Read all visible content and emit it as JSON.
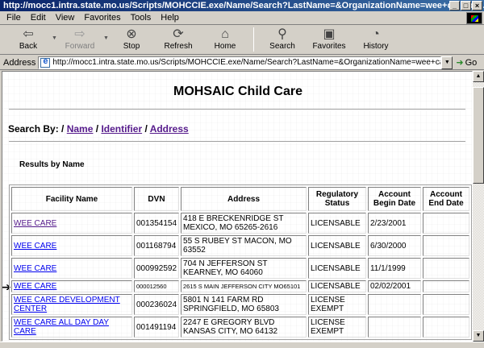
{
  "window": {
    "title": "http://mocc1.intra.state.mo.us/Scripts/MOHCCIE.exe/Name/Search?LastName=&OrganizationName=wee+c - Micr..."
  },
  "menu": [
    "File",
    "Edit",
    "View",
    "Favorites",
    "Tools",
    "Help"
  ],
  "toolbar": {
    "back": "Back",
    "forward": "Forward",
    "stop": "Stop",
    "refresh": "Refresh",
    "home": "Home",
    "search": "Search",
    "favorites": "Favorites",
    "history": "History"
  },
  "address": {
    "label": "Address",
    "url": "http://mocc1.intra.state.mo.us/Scripts/MOHCCIE.exe/Name/Search?LastName=&OrganizationName=wee+care&FirstName=",
    "go": "Go"
  },
  "page": {
    "title": "MOHSAIC Child Care",
    "search_by_prefix": "Search By: /",
    "search_name": "Name",
    "search_identifier": "Identifier",
    "search_address": "Address",
    "sep": "/",
    "results_label": "Results by Name"
  },
  "table": {
    "headers": [
      "Facility Name",
      "DVN",
      "Address",
      "Regulatory Status",
      "Account Begin Date",
      "Account End Date"
    ],
    "rows": [
      {
        "name": "WEE CARE",
        "dvn": "001354154",
        "address": "418 E BRECKENRIDGE ST MEXICO, MO 65265-2616",
        "status": "LICENSABLE",
        "begin": "2/23/2001",
        "end": ""
      },
      {
        "name": "WEE CARE",
        "dvn": "001168794",
        "address": "55 S RUBEY ST MACON, MO 63552",
        "status": "LICENSABLE",
        "begin": "6/30/2000",
        "end": ""
      },
      {
        "name": "WEE CARE",
        "dvn": "000992592",
        "address": "704 N JEFFERSON ST KEARNEY, MO 64060",
        "status": "LICENSABLE",
        "begin": "11/1/1999",
        "end": ""
      },
      {
        "name": "WEE CARE",
        "dvn": "000012560",
        "address": "2615 S MAIN JEFFERSON CITY MO65101",
        "status": "LICENSABLE",
        "begin": "02/02/2001",
        "end": ""
      },
      {
        "name": "WEE CARE DEVELOPMENT CENTER",
        "dvn": "000236024",
        "address": "5801 N 141 FARM RD SPRINGFIELD, MO 65803",
        "status": "LICENSE EXEMPT",
        "begin": "",
        "end": ""
      },
      {
        "name": "WEE CARE ALL DAY DAY CARE",
        "dvn": "001491194",
        "address": "2247 E GREGORY BLVD KANSAS CITY, MO 64132",
        "status": "LICENSE EXEMPT",
        "begin": "",
        "end": ""
      }
    ]
  },
  "colors": {
    "title_bar": "#0a246a",
    "link": "#0000ee",
    "visited": "#551a8b",
    "chrome": "#d4d0c8"
  }
}
